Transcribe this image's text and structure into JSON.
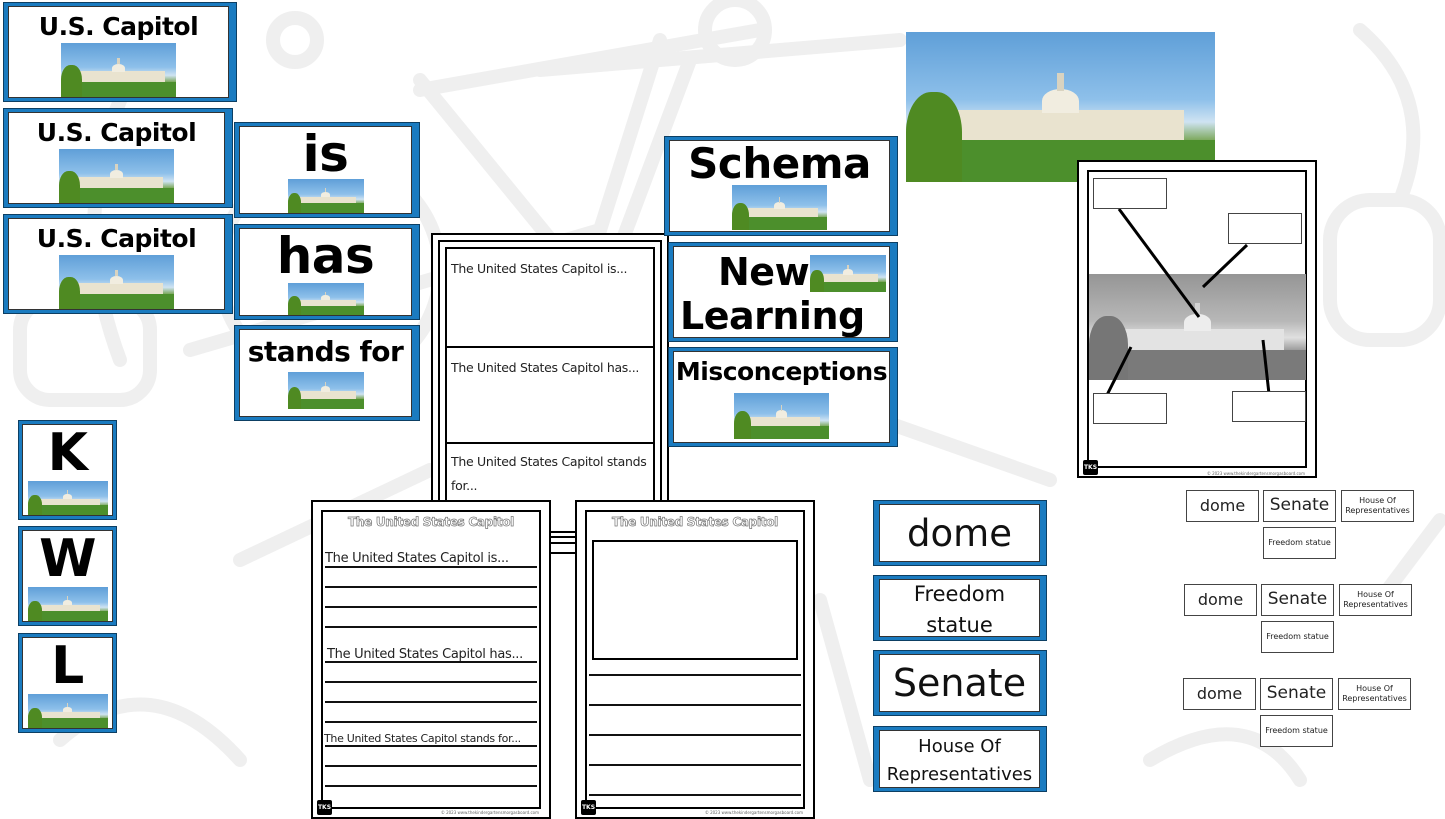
{
  "title_cards": {
    "word": "U.S. Capitol",
    "count": 3
  },
  "sentence_stem_cards": [
    "is",
    "has",
    "stands for"
  ],
  "kwl_cards": [
    "K",
    "W",
    "L"
  ],
  "anchor_chart_headers": {
    "schema": "Schema",
    "new_learning_line1": "New",
    "new_learning_line2": "Learning",
    "misconceptions": "Misconceptions"
  },
  "flip_book": {
    "prompts": [
      "The United States Capitol is...",
      "The United States Capitol has...",
      "The United States Capitol stands for..."
    ],
    "stands_for_line1": "The United States Capitol stands",
    "stands_for_line2": "for..."
  },
  "writing_sheet_lined": {
    "title": "The United States Capitol",
    "prompts": [
      "The United States Capitol is...",
      "The United States Capitol has...",
      "The United States Capitol stands for..."
    ],
    "logo": "TKS",
    "copyright": "© 2023 www.thekindergartensmorgasboard.com"
  },
  "writing_sheet_drawing": {
    "title": "The United States Capitol",
    "logo": "TKS",
    "copyright": "© 2023 www.thekindergartensmorgasboard.com"
  },
  "vocab_cards": [
    {
      "line1": "dome",
      "line2": ""
    },
    {
      "line1": "Freedom",
      "line2": "statue"
    },
    {
      "line1": "Senate",
      "line2": ""
    },
    {
      "line1": "House Of",
      "line2": "Representatives"
    }
  ],
  "label_sheet": {
    "logo": "TKS",
    "copyright": "© 2023 www.thekindergartensmorgasboard.com"
  },
  "label_word_sets": [
    {
      "dome": "dome",
      "senate": "Senate",
      "house_line1": "House Of",
      "house_line2": "Representatives",
      "statue": "Freedom statue"
    },
    {
      "dome": "dome",
      "senate": "Senate",
      "house_line1": "House Of",
      "house_line2": "Representatives",
      "statue": "Freedom statue"
    },
    {
      "dome": "dome",
      "senate": "Senate",
      "house_line1": "House Of",
      "house_line2": "Representatives",
      "statue": "Freedom statue"
    }
  ],
  "colors": {
    "card_frame_blue": "#1a7bc0",
    "background_doodle": "#efefef"
  }
}
